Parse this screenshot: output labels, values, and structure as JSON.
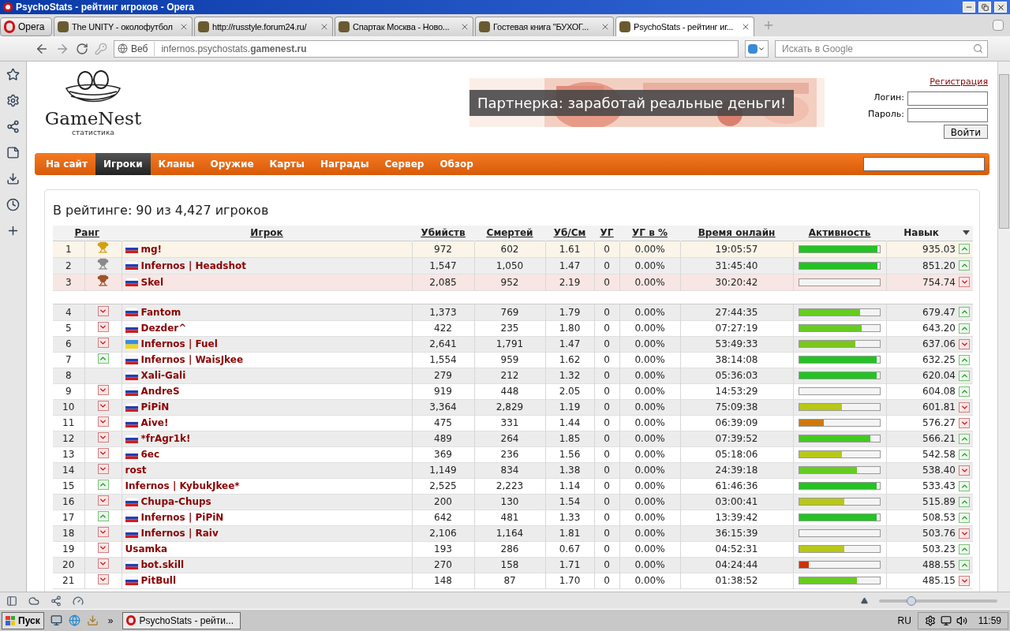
{
  "window": {
    "title": "PsychoStats - рейтинг игроков - Opera"
  },
  "browser": {
    "menu_label": "Opera",
    "tabs": [
      {
        "label": "The UNITY - околофутбол",
        "selected": false
      },
      {
        "label": "http://russtyle.forum24.ru/",
        "selected": false
      },
      {
        "label": "Спартак Москва - Ново...",
        "selected": false
      },
      {
        "label": "Гостевая книга \"БУХОГ...",
        "selected": false
      },
      {
        "label": "PsychoStats - рейтинг иг...",
        "selected": true
      }
    ],
    "address_prefix": "Веб",
    "address": "infernos.psychostats.**gamenest.ru**",
    "search_placeholder": "Искать в Google"
  },
  "site": {
    "logo": "GameNest",
    "logo_sub": "статистика",
    "banner": "Партнерка: заработай реальные деньги!",
    "register": "Регистрация",
    "login_label": "Логин:",
    "password_label": "Пароль:",
    "login_button": "Войти",
    "nav": [
      {
        "label": "На сайт",
        "selected": false
      },
      {
        "label": "Игроки",
        "selected": true
      },
      {
        "label": "Кланы",
        "selected": false
      },
      {
        "label": "Оружие",
        "selected": false
      },
      {
        "label": "Карты",
        "selected": false
      },
      {
        "label": "Награды",
        "selected": false
      },
      {
        "label": "Сервер",
        "selected": false
      },
      {
        "label": "Обзор",
        "selected": false
      }
    ],
    "heading": "В рейтинге: 90 из 4,427 игроков",
    "columns": [
      "Ранг",
      "Игрок",
      "Убийств",
      "Смертей",
      "Уб/См",
      "УГ",
      "УГ в %",
      "Время онлайн",
      "Активность",
      "Навык"
    ],
    "top_rows": [
      {
        "rank": "1",
        "rank_badge": {
          "kind": "gold"
        },
        "flag": {
          "kind": "ru"
        },
        "name": "mg!",
        "kills": "972",
        "deaths": "602",
        "ratio": "1.61",
        "hs": "0",
        "hs_pct": "0.00%",
        "time": "19:05:57",
        "level": 0.97,
        "color": "#22c322",
        "skill": "935.03",
        "trend": {
          "kind": "up"
        }
      },
      {
        "rank": "2",
        "rank_badge": {
          "kind": "silver"
        },
        "flag": {
          "kind": "ru"
        },
        "name": "Infernos | Headshot",
        "kills": "1,547",
        "deaths": "1,050",
        "ratio": "1.47",
        "hs": "0",
        "hs_pct": "0.00%",
        "time": "31:45:40",
        "level": 0.97,
        "color": "#22c322",
        "skill": "851.20",
        "trend": {
          "kind": "up"
        }
      },
      {
        "rank": "3",
        "rank_badge": {
          "kind": "bronze"
        },
        "flag": {
          "kind": "ru"
        },
        "name": "Skel",
        "kills": "2,085",
        "deaths": "952",
        "ratio": "2.19",
        "hs": "0",
        "hs_pct": "0.00%",
        "time": "30:20:42",
        "level": 0,
        "skill": "754.74",
        "trend": {
          "kind": "down"
        }
      }
    ],
    "rows": [
      {
        "rank": "4",
        "rank_badge": {
          "kind": "down"
        },
        "flag": {
          "kind": "ru"
        },
        "name": "Fantom",
        "kills": "1,373",
        "deaths": "769",
        "ratio": "1.79",
        "hs": "0",
        "hs_pct": "0.00%",
        "time": "27:44:35",
        "level": 0.75,
        "color": "#66cc22",
        "skill": "679.47",
        "trend": {
          "kind": "up"
        }
      },
      {
        "rank": "5",
        "rank_badge": {
          "kind": "down"
        },
        "flag": {
          "kind": "ru"
        },
        "name": "Dezder^",
        "kills": "422",
        "deaths": "235",
        "ratio": "1.80",
        "hs": "0",
        "hs_pct": "0.00%",
        "time": "07:27:19",
        "level": 0.77,
        "color": "#66cc22",
        "skill": "643.20",
        "trend": {
          "kind": "up"
        }
      },
      {
        "rank": "6",
        "rank_badge": {
          "kind": "down"
        },
        "flag": {
          "kind": "ua"
        },
        "name": "Infernos | Fuel",
        "kills": "2,641",
        "deaths": "1,791",
        "ratio": "1.47",
        "hs": "0",
        "hs_pct": "0.00%",
        "time": "53:49:33",
        "level": 0.7,
        "color": "#7cc61e",
        "skill": "637.06",
        "trend": {
          "kind": "down"
        }
      },
      {
        "rank": "7",
        "rank_badge": {
          "kind": "up"
        },
        "flag": {
          "kind": "ru"
        },
        "name": "Infernos | WaisJkee",
        "kills": "1,554",
        "deaths": "959",
        "ratio": "1.62",
        "hs": "0",
        "hs_pct": "0.00%",
        "time": "38:14:08",
        "level": 0.96,
        "color": "#22c322",
        "skill": "632.25",
        "trend": {
          "kind": "up"
        }
      },
      {
        "rank": "8",
        "flag": {
          "kind": "ru"
        },
        "name": "Xali-Gali",
        "kills": "279",
        "deaths": "212",
        "ratio": "1.32",
        "hs": "0",
        "hs_pct": "0.00%",
        "time": "05:36:03",
        "level": 0.96,
        "color": "#22c322",
        "skill": "620.04",
        "trend": {
          "kind": "up"
        }
      },
      {
        "rank": "9",
        "rank_badge": {
          "kind": "down"
        },
        "flag": {
          "kind": "ru"
        },
        "name": "AndreS",
        "kills": "919",
        "deaths": "448",
        "ratio": "2.05",
        "hs": "0",
        "hs_pct": "0.00%",
        "time": "14:53:29",
        "level": 0,
        "skill": "604.08",
        "trend": {
          "kind": "up"
        }
      },
      {
        "rank": "10",
        "rank_badge": {
          "kind": "down"
        },
        "flag": {
          "kind": "ru"
        },
        "name": "PiPiN",
        "kills": "3,364",
        "deaths": "2,829",
        "ratio": "1.19",
        "hs": "0",
        "hs_pct": "0.00%",
        "time": "75:09:38",
        "level": 0.53,
        "color": "#b8c818",
        "skill": "601.81",
        "trend": {
          "kind": "down"
        }
      },
      {
        "rank": "11",
        "rank_badge": {
          "kind": "down"
        },
        "flag": {
          "kind": "ru"
        },
        "name": "Aive!",
        "kills": "475",
        "deaths": "331",
        "ratio": "1.44",
        "hs": "0",
        "hs_pct": "0.00%",
        "time": "06:39:09",
        "level": 0.3,
        "color": "#cc7a10",
        "skill": "576.27",
        "trend": {
          "kind": "down"
        }
      },
      {
        "rank": "12",
        "rank_badge": {
          "kind": "down"
        },
        "flag": {
          "kind": "ru"
        },
        "name": "*frAgr1k!",
        "kills": "489",
        "deaths": "264",
        "ratio": "1.85",
        "hs": "0",
        "hs_pct": "0.00%",
        "time": "07:39:52",
        "level": 0.88,
        "color": "#44c822",
        "skill": "566.21",
        "trend": {
          "kind": "up"
        }
      },
      {
        "rank": "13",
        "rank_badge": {
          "kind": "down"
        },
        "flag": {
          "kind": "ru"
        },
        "name": "6ec",
        "kills": "369",
        "deaths": "236",
        "ratio": "1.56",
        "hs": "0",
        "hs_pct": "0.00%",
        "time": "05:18:06",
        "level": 0.53,
        "color": "#b8c818",
        "skill": "542.58",
        "trend": {
          "kind": "up"
        }
      },
      {
        "rank": "14",
        "rank_badge": {
          "kind": "down"
        },
        "name": "rost",
        "kills": "1,149",
        "deaths": "834",
        "ratio": "1.38",
        "hs": "0",
        "hs_pct": "0.00%",
        "time": "24:39:18",
        "level": 0.72,
        "color": "#66cc22",
        "skill": "538.40",
        "trend": {
          "kind": "down"
        }
      },
      {
        "rank": "15",
        "rank_badge": {
          "kind": "up"
        },
        "name": "Infernos | KybukJkee*",
        "kills": "2,525",
        "deaths": "2,223",
        "ratio": "1.14",
        "hs": "0",
        "hs_pct": "0.00%",
        "time": "61:46:36",
        "level": 0.96,
        "color": "#22c322",
        "skill": "533.43",
        "trend": {
          "kind": "up"
        }
      },
      {
        "rank": "16",
        "rank_badge": {
          "kind": "down"
        },
        "flag": {
          "kind": "ru"
        },
        "name": "Chupa-Chups",
        "kills": "200",
        "deaths": "130",
        "ratio": "1.54",
        "hs": "0",
        "hs_pct": "0.00%",
        "time": "03:00:41",
        "level": 0.56,
        "color": "#b8c818",
        "skill": "515.89",
        "trend": {
          "kind": "up"
        }
      },
      {
        "rank": "17",
        "rank_badge": {
          "kind": "up"
        },
        "flag": {
          "kind": "ru"
        },
        "name": "Infernos | PiPiN",
        "kills": "642",
        "deaths": "481",
        "ratio": "1.33",
        "hs": "0",
        "hs_pct": "0.00%",
        "time": "13:39:42",
        "level": 0.96,
        "color": "#22c322",
        "skill": "508.53",
        "trend": {
          "kind": "up"
        }
      },
      {
        "rank": "18",
        "rank_badge": {
          "kind": "down"
        },
        "flag": {
          "kind": "ru"
        },
        "name": "Infernos | Raiv",
        "kills": "2,106",
        "deaths": "1,164",
        "ratio": "1.81",
        "hs": "0",
        "hs_pct": "0.00%",
        "time": "36:15:39",
        "level": 0,
        "skill": "503.76",
        "trend": {
          "kind": "down"
        }
      },
      {
        "rank": "19",
        "rank_badge": {
          "kind": "down"
        },
        "name": "Usamka",
        "kills": "193",
        "deaths": "286",
        "ratio": "0.67",
        "hs": "0",
        "hs_pct": "0.00%",
        "time": "04:52:31",
        "level": 0.56,
        "color": "#b8c818",
        "skill": "503.23",
        "trend": {
          "kind": "up"
        }
      },
      {
        "rank": "20",
        "rank_badge": {
          "kind": "down"
        },
        "flag": {
          "kind": "ru"
        },
        "name": "bot.skill",
        "kills": "270",
        "deaths": "158",
        "ratio": "1.71",
        "hs": "0",
        "hs_pct": "0.00%",
        "time": "04:24:44",
        "level": 0.12,
        "color": "#cc3300",
        "skill": "488.55",
        "trend": {
          "kind": "up"
        }
      },
      {
        "rank": "21",
        "rank_badge": {
          "kind": "down"
        },
        "flag": {
          "kind": "ru"
        },
        "name": "PitBull",
        "kills": "148",
        "deaths": "87",
        "ratio": "1.70",
        "hs": "0",
        "hs_pct": "0.00%",
        "time": "01:38:52",
        "level": 0.72,
        "color": "#66cc22",
        "skill": "485.15",
        "trend": {
          "kind": "down"
        }
      }
    ]
  },
  "zoom": {
    "level": 0.27
  },
  "taskbar": {
    "start": "Пуск",
    "more": "»",
    "task": "PsychoStats - рейти...",
    "language": "RU",
    "clock": "11:59"
  }
}
